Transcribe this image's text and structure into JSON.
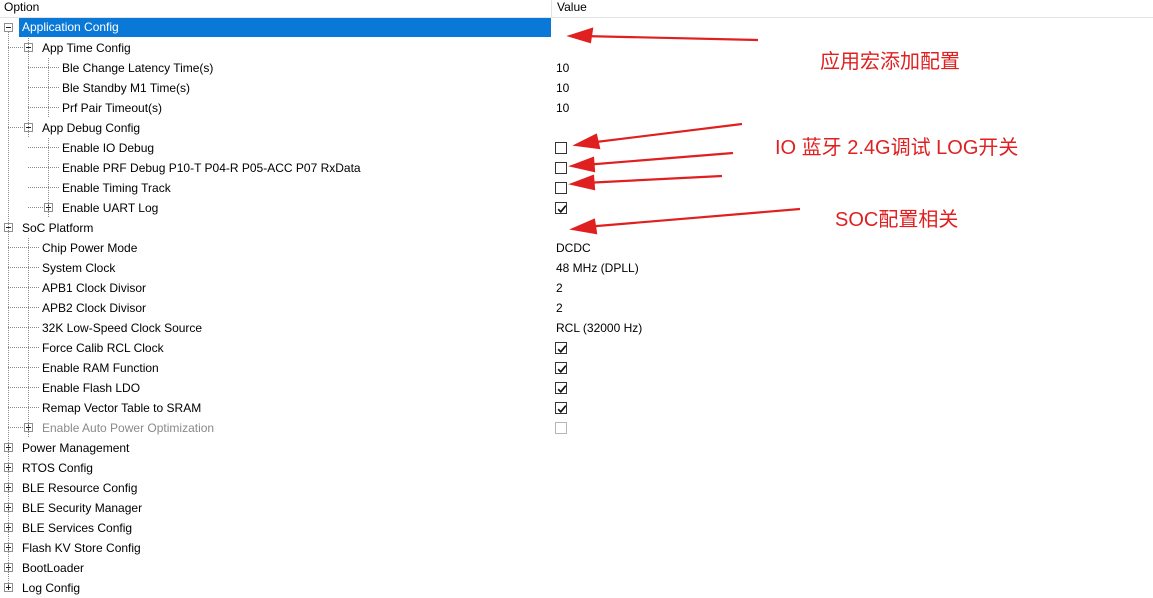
{
  "header": {
    "option_label": "Option",
    "value_label": "Value"
  },
  "rows": [
    {
      "label": "Application Config",
      "value": ""
    },
    {
      "label": "App Time Config",
      "value": ""
    },
    {
      "label": "Ble Change Latency Time(s)",
      "value": "10"
    },
    {
      "label": "Ble Standby M1 Time(s)",
      "value": "10"
    },
    {
      "label": "Prf Pair Timeout(s)",
      "value": "10"
    },
    {
      "label": "App Debug Config",
      "value": ""
    },
    {
      "label": "Enable IO Debug",
      "checked": false
    },
    {
      "label": "Enable PRF Debug P10-T P04-R P05-ACC P07 RxData",
      "checked": false
    },
    {
      "label": "Enable Timing Track",
      "checked": false
    },
    {
      "label": "Enable UART Log",
      "checked": true
    },
    {
      "label": "SoC Platform",
      "value": ""
    },
    {
      "label": "Chip Power Mode",
      "value": "DCDC"
    },
    {
      "label": "System Clock",
      "value": "48 MHz (DPLL)"
    },
    {
      "label": "APB1 Clock Divisor",
      "value": "2"
    },
    {
      "label": "APB2 Clock Divisor",
      "value": "2"
    },
    {
      "label": "32K Low-Speed Clock Source",
      "value": "RCL (32000 Hz)"
    },
    {
      "label": "Force Calib RCL Clock",
      "checked": true
    },
    {
      "label": "Enable RAM Function",
      "checked": true
    },
    {
      "label": "Enable Flash LDO",
      "checked": true
    },
    {
      "label": "Remap Vector Table to SRAM",
      "checked": true
    },
    {
      "label": "Enable Auto Power Optimization",
      "checked": false,
      "disabled": true
    },
    {
      "label": "Power Management",
      "value": ""
    },
    {
      "label": "RTOS Config",
      "value": ""
    },
    {
      "label": "BLE Resource Config",
      "value": ""
    },
    {
      "label": "BLE Security Manager",
      "value": ""
    },
    {
      "label": "BLE Services Config",
      "value": ""
    },
    {
      "label": "Flash KV Store Config",
      "value": ""
    },
    {
      "label": "BootLoader",
      "value": ""
    },
    {
      "label": "Log Config",
      "value": ""
    }
  ],
  "annotations": {
    "app_macro": "应用宏添加配置",
    "io_debug": "IO 蓝牙 2.4G调试 LOG开关",
    "soc_config": "SOC配置相关"
  },
  "colors": {
    "selection": "#0a78d7",
    "annotation": "#e02020"
  }
}
